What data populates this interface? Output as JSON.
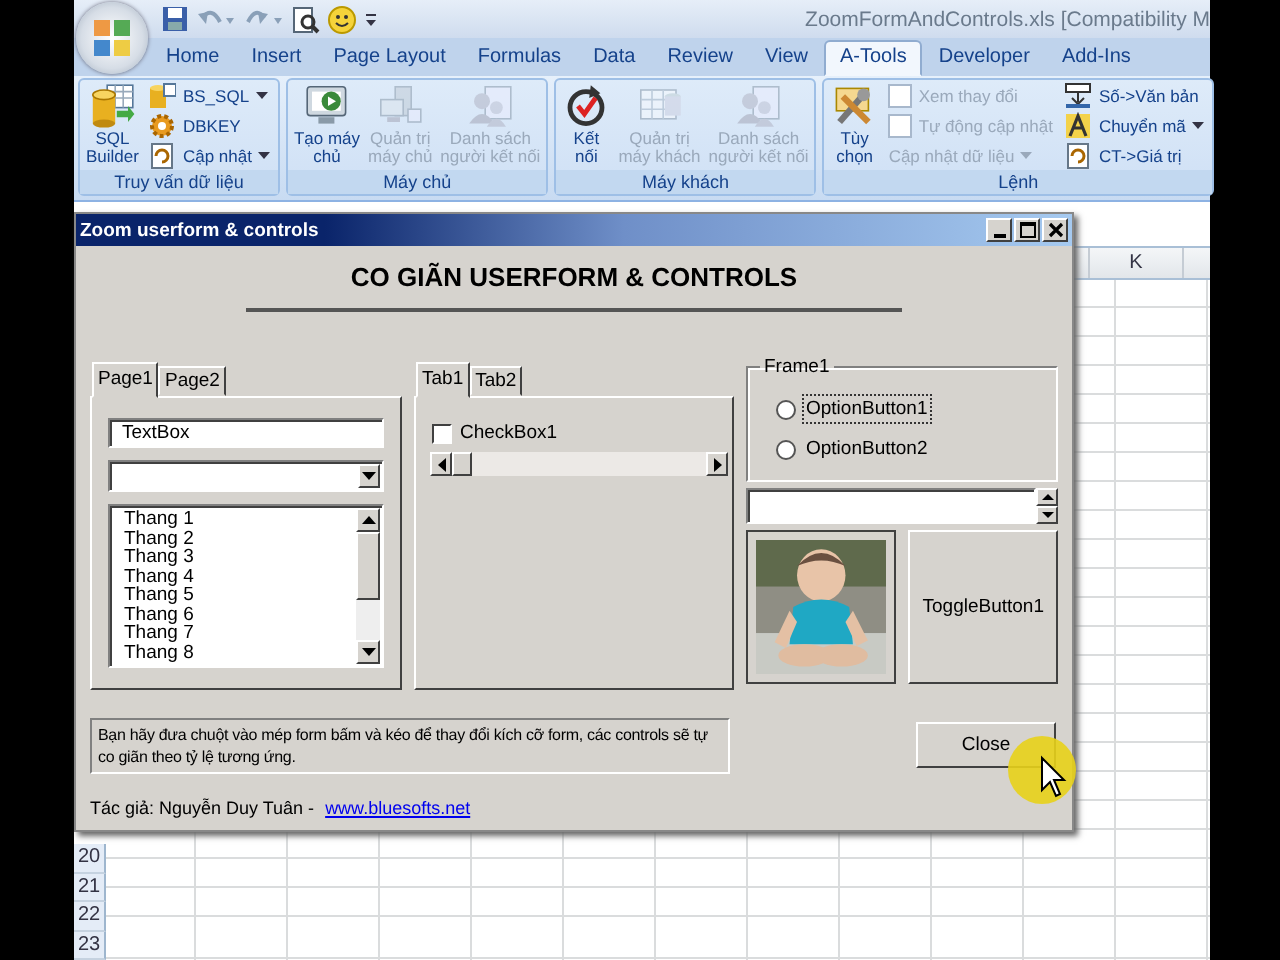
{
  "window": {
    "title": "ZoomFormAndControls.xls  [Compatibility M"
  },
  "ribbon_tabs": [
    {
      "label": "Home",
      "selected": false
    },
    {
      "label": "Insert",
      "selected": false
    },
    {
      "label": "Page Layout",
      "selected": false
    },
    {
      "label": "Formulas",
      "selected": false
    },
    {
      "label": "Data",
      "selected": false
    },
    {
      "label": "Review",
      "selected": false
    },
    {
      "label": "View",
      "selected": false
    },
    {
      "label": "A-Tools",
      "selected": true
    },
    {
      "label": "Developer",
      "selected": false
    },
    {
      "label": "Add-Ins",
      "selected": false
    }
  ],
  "ribbon_groups": [
    {
      "label": "Truy vấn dữ liệu",
      "columns": [
        [
          {
            "kind": "large",
            "label": "SQL\nBuilder",
            "disabled": false,
            "dropdown": false
          }
        ],
        [
          {
            "kind": "small",
            "label": "BS_SQL",
            "disabled": false,
            "dropdown": true
          },
          {
            "kind": "small",
            "label": "DBKEY",
            "disabled": false,
            "dropdown": false
          },
          {
            "kind": "small",
            "label": "Cập nhật",
            "disabled": false,
            "dropdown": true
          }
        ]
      ]
    },
    {
      "label": "Máy chủ",
      "columns": [
        [
          {
            "kind": "large",
            "label": "Tạo máy\nchủ",
            "disabled": false,
            "dropdown": false
          }
        ],
        [
          {
            "kind": "large",
            "label": "Quản trị\nmáy chủ",
            "disabled": true,
            "dropdown": false
          }
        ],
        [
          {
            "kind": "large",
            "label": "Danh sách\nngười kết nối",
            "disabled": true,
            "dropdown": false
          }
        ]
      ]
    },
    {
      "label": "Máy khách",
      "columns": [
        [
          {
            "kind": "large",
            "label": "Kết\nnối",
            "disabled": false,
            "dropdown": false
          }
        ],
        [
          {
            "kind": "large",
            "label": "Quản trị\nmáy khách",
            "disabled": true,
            "dropdown": false
          }
        ],
        [
          {
            "kind": "large",
            "label": "Danh sách\nngười kết nối",
            "disabled": true,
            "dropdown": false
          }
        ]
      ]
    },
    {
      "label": "Lệnh",
      "columns": [
        [
          {
            "kind": "large",
            "label": "Tùy\nchọn",
            "disabled": false,
            "dropdown": false
          }
        ],
        [
          {
            "kind": "check",
            "label": "Xem thay đổi",
            "disabled": true,
            "dropdown": false,
            "checked": false
          },
          {
            "kind": "check",
            "label": "Tự động cập nhật",
            "disabled": true,
            "dropdown": false,
            "checked": false
          },
          {
            "kind": "small",
            "label": "Cập nhật dữ liệu",
            "disabled": true,
            "dropdown": true
          }
        ],
        [
          {
            "kind": "small",
            "label": "Số->Văn bản",
            "disabled": false,
            "dropdown": false
          },
          {
            "kind": "small",
            "label": "Chuyển mã",
            "disabled": false,
            "dropdown": true
          },
          {
            "kind": "small",
            "label": "CT->Giá trị",
            "disabled": false,
            "dropdown": false
          }
        ]
      ]
    }
  ],
  "sheet": {
    "column_header": "K",
    "row_numbers": [
      "20",
      "21",
      "22",
      "23"
    ]
  },
  "userform": {
    "title": "Zoom userform & controls",
    "heading": "CO GIÃN USERFORM & CONTROLS",
    "multipage": {
      "tabs": [
        {
          "label": "Page1",
          "selected": true
        },
        {
          "label": "Page2",
          "selected": false
        }
      ],
      "textbox": "TextBox",
      "listbox": [
        "Thang 1",
        "Thang 2",
        "Thang 3",
        "Thang 4",
        "Thang 5",
        "Thang 6",
        "Thang 7",
        "Thang 8"
      ]
    },
    "tabstrip": {
      "tabs": [
        {
          "label": "Tab1",
          "selected": true
        },
        {
          "label": "Tab2",
          "selected": false
        }
      ],
      "checkbox": {
        "label": "CheckBox1",
        "checked": false
      }
    },
    "frame": {
      "caption": "Frame1",
      "options": [
        {
          "label": "OptionButton1",
          "selected": false,
          "focused": true
        },
        {
          "label": "OptionButton2",
          "selected": false,
          "focused": false
        }
      ]
    },
    "toggle": {
      "label": "ToggleButton1",
      "on": false
    },
    "note": "Bạn hãy đưa chuột vào mép form bấm và kéo để thay đổi kích cỡ form, các controls sẽ tự co giãn theo tỷ lệ tương ứng.",
    "close_button": "Close",
    "author": "Tác giả: Nguyễn Duy Tuân - ",
    "link": "www.bluesofts.net"
  }
}
